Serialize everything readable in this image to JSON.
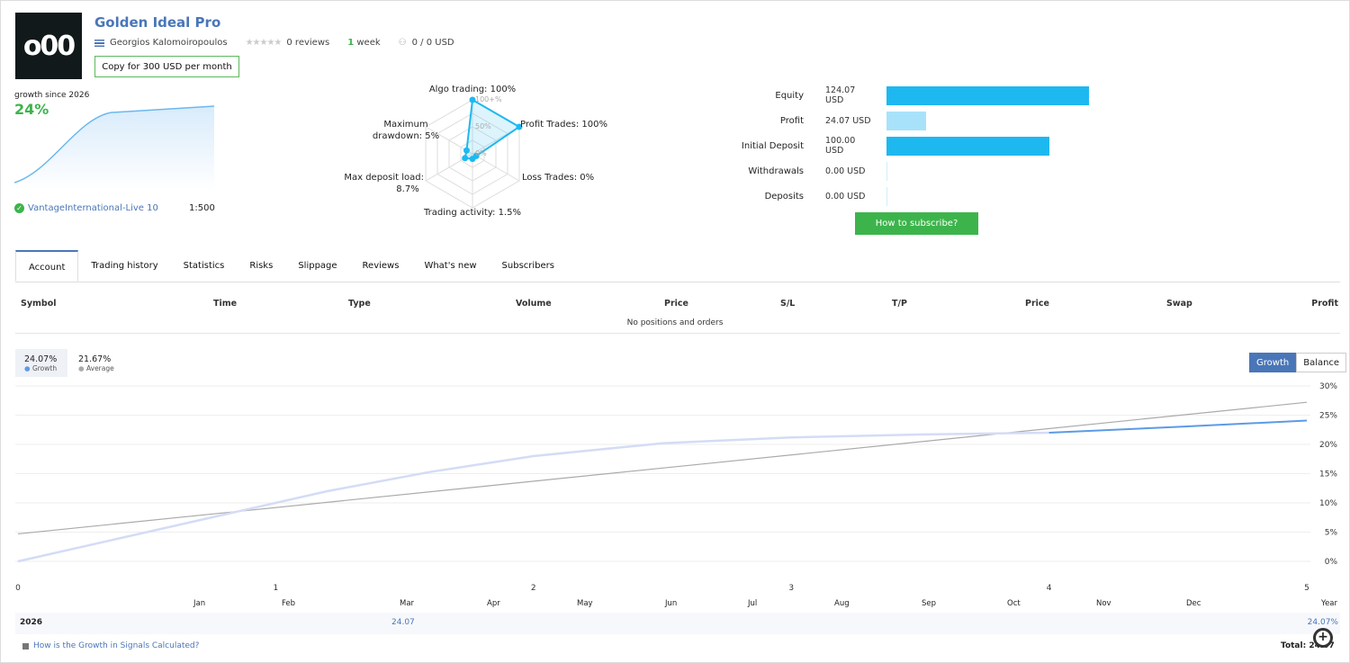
{
  "header": {
    "title": "Golden Ideal Pro",
    "logo_text": "o00",
    "author": "Georgios Kalomoiropoulos",
    "reviews": "0 reviews",
    "age_num": "1",
    "age_unit": "week",
    "subscribers": "0 / 0 USD",
    "copy_button": "Copy for 300 USD per month",
    "rating": 0
  },
  "growth_summary": {
    "label": "growth since 2026",
    "value": "24%",
    "broker": "VantageInternational-Live 10",
    "leverage": "1:500"
  },
  "radar": {
    "labels": [
      "Algo trading: 100%",
      "Profit Trades: 100%",
      "Loss Trades: 0%",
      "Trading activity: 1.5%",
      "Max deposit load: 8.7%",
      "Maximum drawdown: 5%"
    ],
    "ticks": [
      "100+%",
      "50%",
      "0%"
    ],
    "values": [
      100,
      100,
      0,
      1.5,
      8.7,
      5
    ]
  },
  "balance": {
    "rows": [
      {
        "label": "Equity",
        "value": "124.07 USD",
        "amount": 124.07,
        "color": "#1eb8f0"
      },
      {
        "label": "Profit",
        "value": "24.07 USD",
        "amount": 24.07,
        "color": "#a8e2fa"
      },
      {
        "label": "Initial Deposit",
        "value": "100.00 USD",
        "amount": 100,
        "color": "#1eb8f0"
      },
      {
        "label": "Withdrawals",
        "value": "0.00 USD",
        "amount": 0,
        "color": "#1eb8f0"
      },
      {
        "label": "Deposits",
        "value": "0.00 USD",
        "amount": 0,
        "color": "#1eb8f0"
      }
    ],
    "subscribe": "How to subscribe?"
  },
  "tabs": [
    "Account",
    "Trading history",
    "Statistics",
    "Risks",
    "Slippage",
    "Reviews",
    "What's new",
    "Subscribers"
  ],
  "table": {
    "headers": [
      "Symbol",
      "Time",
      "Type",
      "Volume",
      "Price",
      "S/L",
      "T/P",
      "Price",
      "Swap",
      "Profit"
    ],
    "empty": "No positions and orders"
  },
  "chart_legend": {
    "growth_value": "24.07%",
    "growth_label": "Growth",
    "average_value": "21.67%",
    "average_label": "Average",
    "btn_growth": "Growth",
    "btn_balance": "Balance"
  },
  "chart_data": {
    "type": "line",
    "xlim": [
      0,
      5
    ],
    "ylim": [
      0,
      30
    ],
    "x_ticks": [
      "0",
      "1",
      "2",
      "3",
      "4",
      "5"
    ],
    "y_ticks": [
      "0%",
      "5%",
      "10%",
      "15%",
      "20%",
      "25%",
      "30%"
    ],
    "grid": true,
    "series": [
      {
        "name": "Growth",
        "color": "#5b9be6",
        "x": [
          0,
          0.4,
          0.8,
          1.2,
          1.6,
          2,
          2.5,
          3,
          3.5,
          4,
          4.5,
          5
        ],
        "y": [
          0,
          4,
          8,
          12,
          15.3,
          18,
          20.2,
          21.2,
          21.7,
          22,
          23,
          24.07
        ]
      },
      {
        "name": "Average",
        "color": "#aaaaaa",
        "x": [
          0,
          5
        ],
        "y": [
          4.7,
          27.2
        ]
      }
    ]
  },
  "months": {
    "headers": [
      "Jan",
      "Feb",
      "Mar",
      "Apr",
      "May",
      "Jun",
      "Jul",
      "Aug",
      "Sep",
      "Oct",
      "Nov",
      "Dec",
      "Year"
    ],
    "year": "2026",
    "mar": "24.07",
    "total_year": "24.07%"
  },
  "footer": {
    "link": "How is the Growth in Signals Calculated?",
    "total": "Total: 24.07%"
  }
}
